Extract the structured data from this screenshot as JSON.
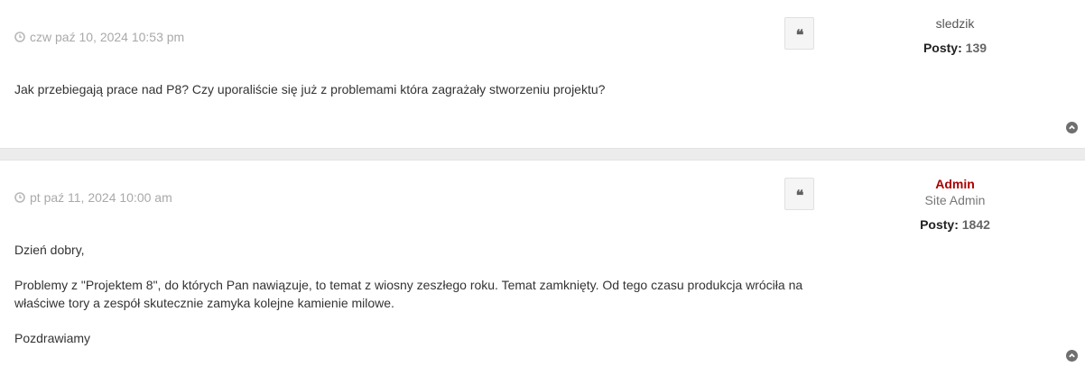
{
  "posts": [
    {
      "date": "czw paź 10, 2024 10:53 pm",
      "author": "sledzik",
      "rank": "",
      "posts_label": "Posty:",
      "posts_count": "139",
      "paragraphs": [
        "Jak przebiegają prace nad P8? Czy uporaliście się już z problemami która zagrażały stworzeniu projektu?"
      ]
    },
    {
      "date": "pt paź 11, 2024 10:00 am",
      "author": "Admin",
      "rank": "Site Admin",
      "posts_label": "Posty:",
      "posts_count": "1842",
      "paragraphs": [
        "Dzień dobry,",
        "Problemy z \"Projektem 8\", do których Pan nawiązuje, to temat z wiosny zeszłego roku. Temat zamknięty. Od tego czasu produkcja wróciła na właściwe tory a zespół skutecznie zamyka kolejne kamienie milowe.",
        "Pozdrawiamy"
      ]
    }
  ],
  "quote_glyph": "❝",
  "icons": {
    "date": "clock-icon",
    "quote": "quote-icon",
    "top": "chevron-up-circle-icon"
  },
  "colors": {
    "admin": "#aa0000",
    "meta": "#a9a9a9",
    "text": "#333333"
  }
}
